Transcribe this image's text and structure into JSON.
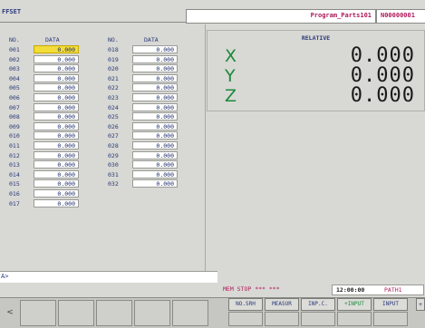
{
  "header": {
    "screen_title": "FFSET",
    "program_name": "Program_Parts101",
    "program_number": "N00000001"
  },
  "offset_table": {
    "left": {
      "no_header": "NO.",
      "data_header": "DATA",
      "rows": [
        {
          "no": "001",
          "value": "0.000",
          "selected": true
        },
        {
          "no": "002",
          "value": "0.000"
        },
        {
          "no": "003",
          "value": "0.000"
        },
        {
          "no": "004",
          "value": "0.000"
        },
        {
          "no": "005",
          "value": "0.000"
        },
        {
          "no": "006",
          "value": "0.000"
        },
        {
          "no": "007",
          "value": "0.000"
        },
        {
          "no": "008",
          "value": "0.000"
        },
        {
          "no": "009",
          "value": "0.000"
        },
        {
          "no": "010",
          "value": "0.000"
        },
        {
          "no": "011",
          "value": "0.000"
        },
        {
          "no": "012",
          "value": "0.000"
        },
        {
          "no": "013",
          "value": "0.000"
        },
        {
          "no": "014",
          "value": "0.000"
        },
        {
          "no": "015",
          "value": "0.000"
        },
        {
          "no": "016",
          "value": "0.000"
        },
        {
          "no": "017",
          "value": "0.000"
        }
      ]
    },
    "right": {
      "no_header": "NO.",
      "data_header": "DATA",
      "rows": [
        {
          "no": "018",
          "value": "0.000"
        },
        {
          "no": "019",
          "value": "0.000"
        },
        {
          "no": "020",
          "value": "0.000"
        },
        {
          "no": "021",
          "value": "0.000"
        },
        {
          "no": "022",
          "value": "0.000"
        },
        {
          "no": "023",
          "value": "0.000"
        },
        {
          "no": "024",
          "value": "0.000"
        },
        {
          "no": "025",
          "value": "0.000"
        },
        {
          "no": "026",
          "value": "0.000"
        },
        {
          "no": "027",
          "value": "0.000"
        },
        {
          "no": "028",
          "value": "0.000"
        },
        {
          "no": "029",
          "value": "0.000"
        },
        {
          "no": "030",
          "value": "0.000"
        },
        {
          "no": "031",
          "value": "0.000"
        },
        {
          "no": "032",
          "value": "0.000"
        }
      ]
    }
  },
  "relative": {
    "title": "RELATIVE",
    "axes": [
      {
        "name": "X",
        "value": "0.000"
      },
      {
        "name": "Y",
        "value": "0.000"
      },
      {
        "name": "Z",
        "value": "0.000"
      }
    ]
  },
  "command_line": {
    "prompt": "A>",
    "value": ""
  },
  "status_bar": {
    "mode": "MEM  STOP *** ***",
    "time": "12:00:00",
    "path": "PATH1"
  },
  "softkeys": {
    "prev_arrow": "<",
    "labels": [
      "NO.SRH",
      "MEASUR",
      "INP.C.",
      "+INPUT",
      "INPUT"
    ],
    "next_arrow": "+"
  },
  "colors": {
    "selection": "#f2dd3a",
    "axis_letter": "#1c8a3c",
    "status_text": "#b0185a",
    "label_text": "#2b3a7a",
    "background": "#d8d8d4"
  }
}
